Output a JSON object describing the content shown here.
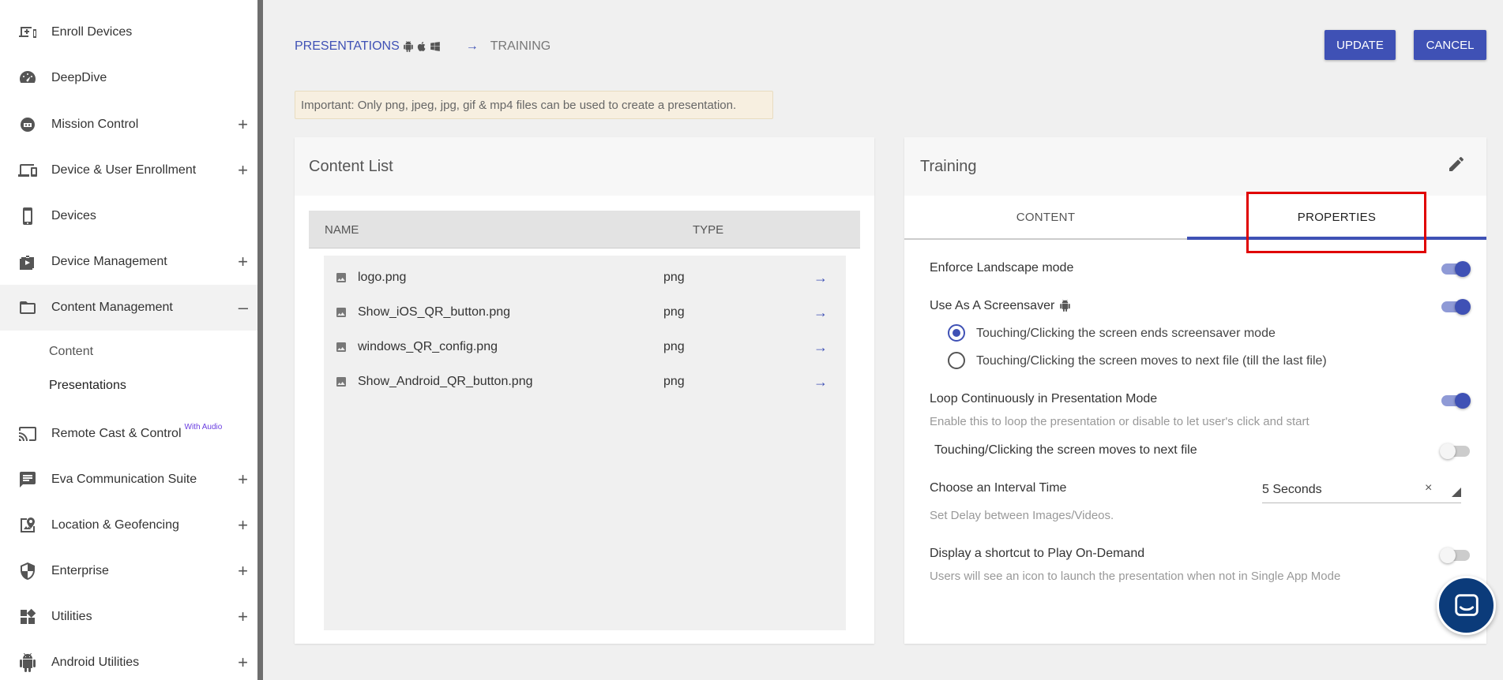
{
  "sidebar": {
    "items": [
      {
        "label": "Enroll Devices",
        "icon": "enroll-icon",
        "toggle": ""
      },
      {
        "label": "DeepDive",
        "icon": "speedometer-icon",
        "toggle": ""
      },
      {
        "label": "Mission Control",
        "icon": "mission-control-icon",
        "toggle": "+"
      },
      {
        "label": "Device & User Enrollment",
        "icon": "devices-icon",
        "toggle": "+"
      },
      {
        "label": "Devices",
        "icon": "phone-icon",
        "toggle": ""
      },
      {
        "label": "Device Management",
        "icon": "device-management-icon",
        "toggle": "+"
      },
      {
        "label": "Content Management",
        "icon": "folder-icon",
        "toggle": "–"
      },
      {
        "label": "Remote Cast & Control",
        "icon": "cast-icon",
        "toggle": "",
        "badge": "With Audio"
      },
      {
        "label": "Eva Communication Suite",
        "icon": "chat-icon",
        "toggle": "+"
      },
      {
        "label": "Location & Geofencing",
        "icon": "map-pin-icon",
        "toggle": "+"
      },
      {
        "label": "Enterprise",
        "icon": "shield-icon",
        "toggle": "+"
      },
      {
        "label": "Utilities",
        "icon": "widgets-icon",
        "toggle": "+"
      },
      {
        "label": "Android Utilities",
        "icon": "android-icon",
        "toggle": "+"
      }
    ],
    "sub_items": [
      "Content",
      "Presentations"
    ]
  },
  "breadcrumb": {
    "root": "PRESENTATIONS",
    "arrow": "→",
    "current": "TRAINING"
  },
  "actions": {
    "update": "UPDATE",
    "cancel": "CANCEL"
  },
  "notice": "Important: Only png, jpeg, jpg, gif & mp4 files can be used to create a presentation.",
  "content_list": {
    "title": "Content List",
    "columns": [
      "NAME",
      "TYPE"
    ],
    "rows": [
      {
        "name": "logo.png",
        "type": "png",
        "arrow": "→"
      },
      {
        "name": "Show_iOS_QR_button.png",
        "type": "png",
        "arrow": "→"
      },
      {
        "name": "windows_QR_config.png",
        "type": "png",
        "arrow": "→"
      },
      {
        "name": "Show_Android_QR_button.png",
        "type": "png",
        "arrow": "→"
      }
    ]
  },
  "properties_panel": {
    "title": "Training",
    "tabs": [
      "CONTENT",
      "PROPERTIES"
    ],
    "active_tab": "PROPERTIES",
    "enforce_landscape": {
      "label": "Enforce Landscape mode",
      "on": true
    },
    "screensaver": {
      "label": "Use As A Screensaver",
      "on": true
    },
    "radio_options": [
      {
        "label": "Touching/Clicking the screen ends screensaver mode",
        "checked": true
      },
      {
        "label": "Touching/Clicking the screen moves to next file (till the last file)",
        "checked": false
      }
    ],
    "loop": {
      "label": "Loop Continuously in Presentation Mode",
      "desc": "Enable this to loop the presentation or disable to let user's click and start",
      "on": true
    },
    "next_file": {
      "label": "Touching/Clicking the screen moves to next file",
      "on": false
    },
    "interval": {
      "label": "Choose an Interval Time",
      "desc": "Set Delay between Images/Videos.",
      "value": "5 Seconds",
      "clear": "×"
    },
    "shortcut": {
      "label": "Display a shortcut to Play On-Demand",
      "desc": "Users will see an icon to launch the presentation when not in Single App Mode",
      "on": false
    }
  },
  "colors": {
    "accent": "#3f51b5",
    "highlight": "#e00000",
    "notice_bg": "#f7efe0",
    "chat_button": "#0b3b7a"
  }
}
